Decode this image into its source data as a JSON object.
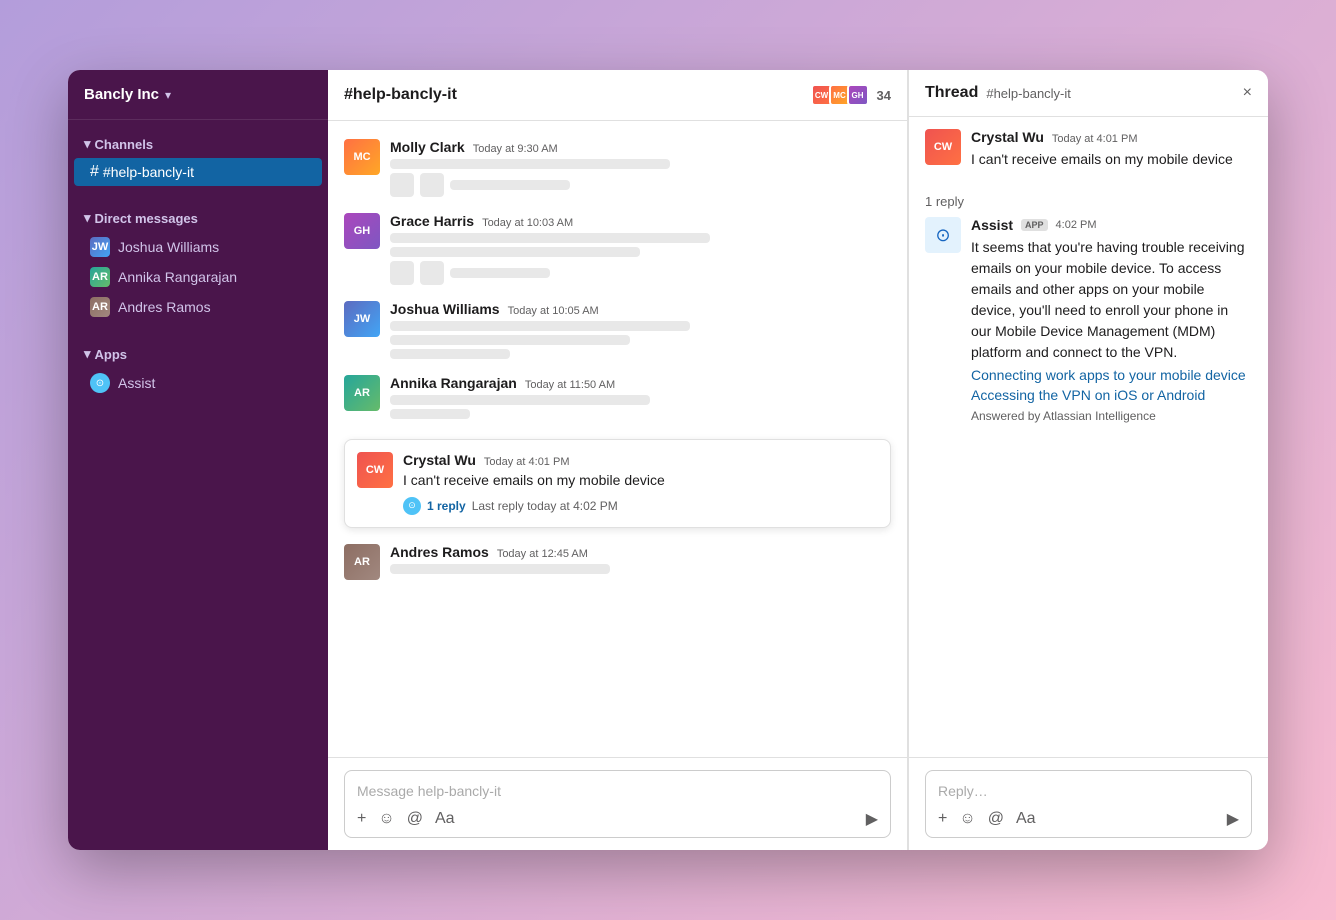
{
  "workspace": {
    "name": "Bancly Inc",
    "chevron": "▾"
  },
  "sidebar": {
    "channels_label": "Channels",
    "active_channel": "#help-bancly-it",
    "direct_messages_label": "Direct messages",
    "direct_messages": [
      {
        "name": "Joshua Williams",
        "avatar_class": "av-joshua",
        "initials": "JW"
      },
      {
        "name": "Annika Rangarajan",
        "avatar_class": "av-annika",
        "initials": "AR"
      },
      {
        "name": "Andres Ramos",
        "avatar_class": "av-andres",
        "initials": "AR2"
      }
    ],
    "apps_label": "Apps",
    "apps": [
      {
        "name": "Assist"
      }
    ]
  },
  "chat": {
    "channel_name": "#help-bancly-it",
    "member_count": "34",
    "messages": [
      {
        "author": "Molly Clark",
        "time": "Today at 9:30 AM",
        "avatar_class": "av-molly",
        "initials": "MC"
      },
      {
        "author": "Grace Harris",
        "time": "Today at 10:03 AM",
        "avatar_class": "av-grace",
        "initials": "GH"
      },
      {
        "author": "Joshua Williams",
        "time": "Today at 10:05 AM",
        "avatar_class": "av-joshua",
        "initials": "JW"
      },
      {
        "author": "Annika Rangarajan",
        "time": "Today at 11:50 AM",
        "avatar_class": "av-annika",
        "initials": "AR"
      }
    ],
    "highlighted_message": {
      "author": "Crystal Wu",
      "time": "Today at 4:01 PM",
      "text": "I can't receive emails on my mobile device",
      "avatar_class": "av-crystal",
      "initials": "CW",
      "reply_count": "1 reply",
      "reply_last": "Last reply today at 4:02 PM"
    },
    "last_message": {
      "author": "Andres Ramos",
      "time": "Today at 12:45 AM",
      "avatar_class": "av-andres",
      "initials": "AR"
    },
    "input_placeholder": "Message help-bancly-it"
  },
  "thread": {
    "title": "Thread",
    "channel": "#help-bancly-it",
    "close_label": "×",
    "messages": [
      {
        "author": "Crystal Wu",
        "time": "Today at 4:01 PM",
        "text": "I can't receive emails on my mobile device",
        "avatar_class": "av-crystal",
        "initials": "CW",
        "is_app": false
      }
    ],
    "reply_count": "1 reply",
    "assist_message": {
      "author": "Assist",
      "app_badge": "APP",
      "time": "4:02 PM",
      "text": "It seems that you're having trouble receiving emails on your mobile device. To access emails and other apps on your mobile device, you'll need to enroll your phone in our Mobile Device Management (MDM) platform and connect to the VPN.",
      "link1": "Connecting work apps to your mobile device",
      "link2": "Accessing the VPN on iOS or Android",
      "answered_by": "Answered by Atlassian Intelligence"
    },
    "input_placeholder": "Reply…"
  },
  "icons": {
    "plus": "+",
    "emoji": "☺",
    "at": "@",
    "font": "Aa",
    "send": "▶"
  }
}
